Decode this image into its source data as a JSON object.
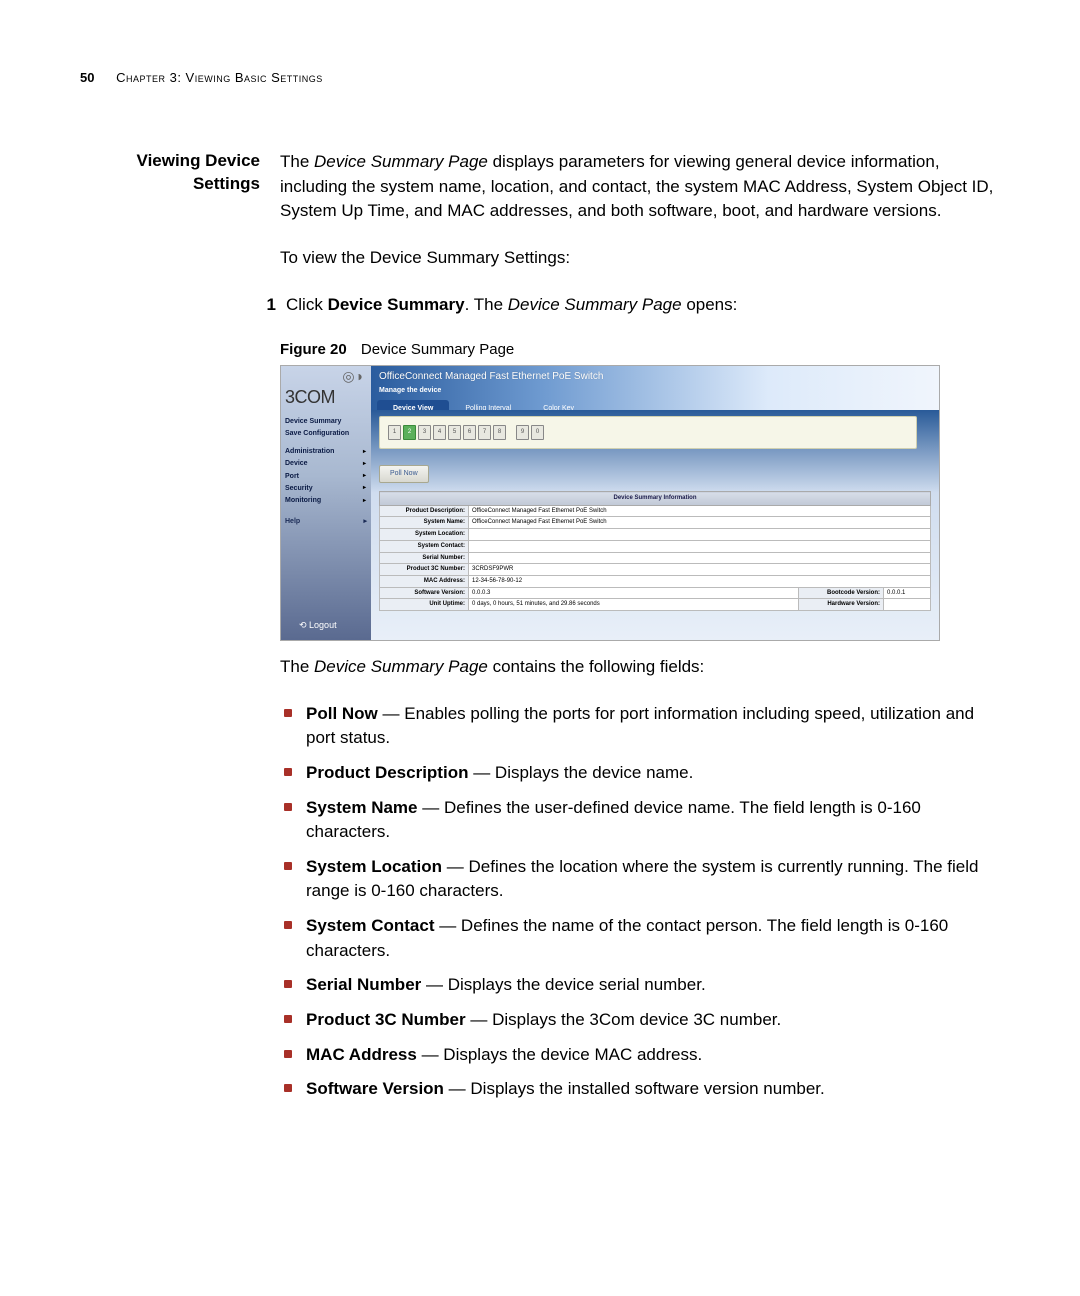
{
  "page": {
    "number": "50",
    "chapter": "Chapter 3: Viewing Basic Settings"
  },
  "section": {
    "title_line1": "Viewing Device",
    "title_line2": "Settings"
  },
  "intro": {
    "text_pre": "The ",
    "text_em": "Device Summary Page",
    "text_post": " displays parameters for viewing general device information, including the system name, location, and contact, the system MAC Address, System Object ID, System Up Time, and MAC addresses, and both software, boot, and hardware versions."
  },
  "lead": "To view the Device Summary Settings:",
  "step1": {
    "num": "1",
    "pre": "Click ",
    "bold": "Device Summary",
    "mid": ". The ",
    "em": "Device Summary Page",
    "post": " opens:"
  },
  "figure": {
    "label": "Figure 20",
    "caption": "Device Summary Page"
  },
  "screenshot": {
    "brand_swirl": "◎◑",
    "brand": "3COM",
    "sidebar": {
      "device_summary": "Device Summary",
      "save_config": "Save Configuration",
      "menu": {
        "administration": "Administration",
        "device": "Device",
        "port": "Port",
        "security": "Security",
        "monitoring": "Monitoring"
      },
      "help": "Help",
      "logout": "⟲ Logout"
    },
    "header_title": "OfficeConnect Managed Fast Ethernet PoE Switch",
    "header_sub": "Manage the device",
    "tabs": {
      "device_view": "Device View",
      "polling_interval": "Polling Interval",
      "color_key": "Color Key"
    },
    "ports": [
      "1",
      "2",
      "3",
      "4",
      "5",
      "6",
      "7",
      "8",
      "9",
      "0"
    ],
    "poll_now": "Poll Now",
    "table": {
      "header": "Device Summary Information",
      "product_description_lbl": "Product Description:",
      "product_description_val": "OfficeConnect Managed Fast Ethernet PoE Switch",
      "system_name_lbl": "System Name:",
      "system_name_val": "OfficeConnect Managed Fast Ethernet PoE Switch",
      "system_location_lbl": "System Location:",
      "system_location_val": "",
      "system_contact_lbl": "System Contact:",
      "system_contact_val": "",
      "serial_number_lbl": "Serial Number:",
      "serial_number_val": "",
      "product_3c_lbl": "Product 3C Number:",
      "product_3c_val": "3CRDSF9PWR",
      "mac_lbl": "MAC Address:",
      "mac_val": "12-34-56-78-90-12",
      "sw_version_lbl": "Software Version:",
      "sw_version_val": "0.0.0.3",
      "bootcode_lbl": "Bootcode Version:",
      "bootcode_val": "0.0.0.1",
      "uptime_lbl": "Unit Uptime:",
      "uptime_val": "0 days, 0 hours, 51 minutes, and 29.86 seconds",
      "hw_version_lbl": "Hardware Version:",
      "hw_version_val": ""
    }
  },
  "after_figure": {
    "pre": "The ",
    "em": "Device Summary Page",
    "post": " contains the following fields:"
  },
  "bullets": [
    {
      "term": "Poll Now",
      "desc": " — Enables polling the ports for port information including speed, utilization and port status."
    },
    {
      "term": "Product Description",
      "desc": " — Displays the device name."
    },
    {
      "term": "System Name",
      "desc": " — Defines the user-defined device name. The field length is 0-160 characters."
    },
    {
      "term": "System Location",
      "desc": " — Defines the location where the system is currently running. The field range is 0-160 characters."
    },
    {
      "term": "System Contact",
      "desc": " — Defines the name of the contact person. The field length is 0-160 characters."
    },
    {
      "term": "Serial Number",
      "desc": " — Displays the device serial number."
    },
    {
      "term": "Product 3C Number",
      "desc": " — Displays the 3Com device 3C number."
    },
    {
      "term": "MAC Address",
      "desc": " — Displays the device MAC address."
    },
    {
      "term": "Software Version",
      "desc": " — Displays the installed software version number."
    }
  ]
}
